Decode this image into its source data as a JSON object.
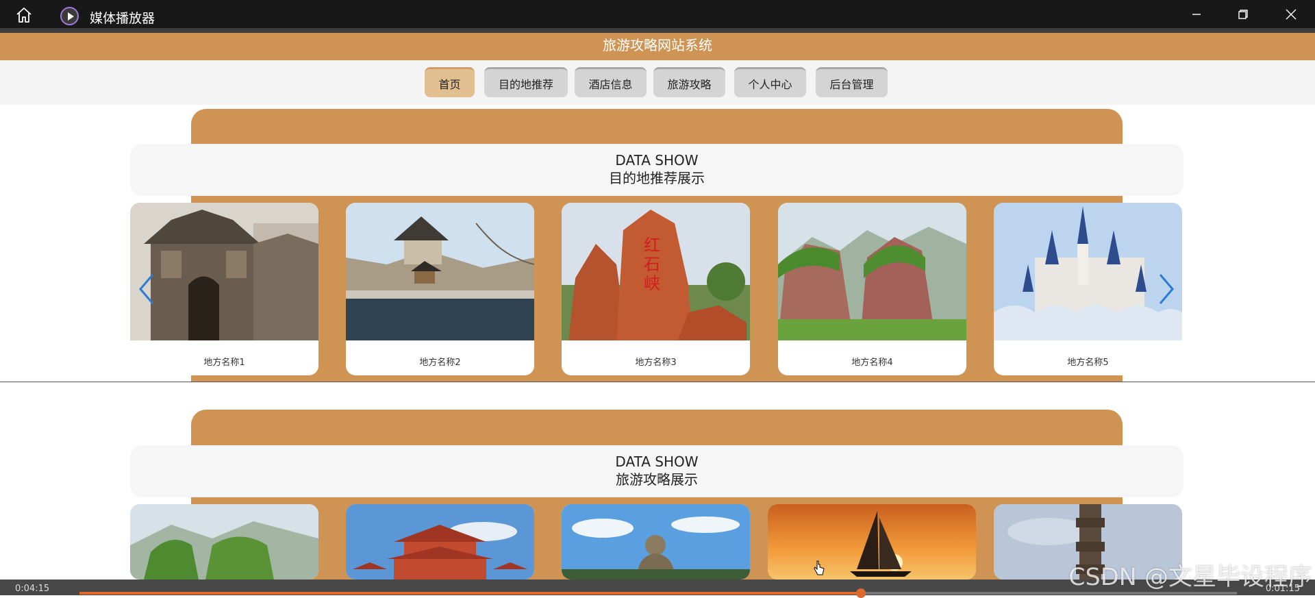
{
  "player": {
    "app_title": "媒体播放器",
    "time_elapsed": "0:04:15",
    "time_remaining": "0:01:15",
    "progress_fraction": 0.675
  },
  "site": {
    "title": "旅游攻略网站系统",
    "accent_color": "#cf9454"
  },
  "nav": {
    "items": [
      {
        "label": "首页",
        "active": true
      },
      {
        "label": "目的地推荐",
        "active": false
      },
      {
        "label": "酒店信息",
        "active": false
      },
      {
        "label": "旅游攻略",
        "active": false
      },
      {
        "label": "个人中心",
        "active": false
      },
      {
        "label": "后台管理",
        "active": false
      }
    ]
  },
  "sections": [
    {
      "title_en": "DATA SHOW",
      "title_cn": "目的地推荐展示",
      "cards": [
        {
          "label": "地方名称1",
          "image": "ancient-gate"
        },
        {
          "label": "地方名称2",
          "image": "pavilion-lake"
        },
        {
          "label": "地方名称3",
          "image": "red-rock"
        },
        {
          "label": "地方名称4",
          "image": "green-mountains"
        },
        {
          "label": "地方名称5",
          "image": "castle"
        }
      ]
    },
    {
      "title_en": "DATA SHOW",
      "title_cn": "旅游攻略展示",
      "cards": [
        {
          "label": "",
          "image": "green-mountains"
        },
        {
          "label": "",
          "image": "temple"
        },
        {
          "label": "",
          "image": "buddha"
        },
        {
          "label": "",
          "image": "sailboat-sunset"
        },
        {
          "label": "",
          "image": "totem"
        }
      ]
    }
  ],
  "watermark": "CSDN @文星毕设程序"
}
